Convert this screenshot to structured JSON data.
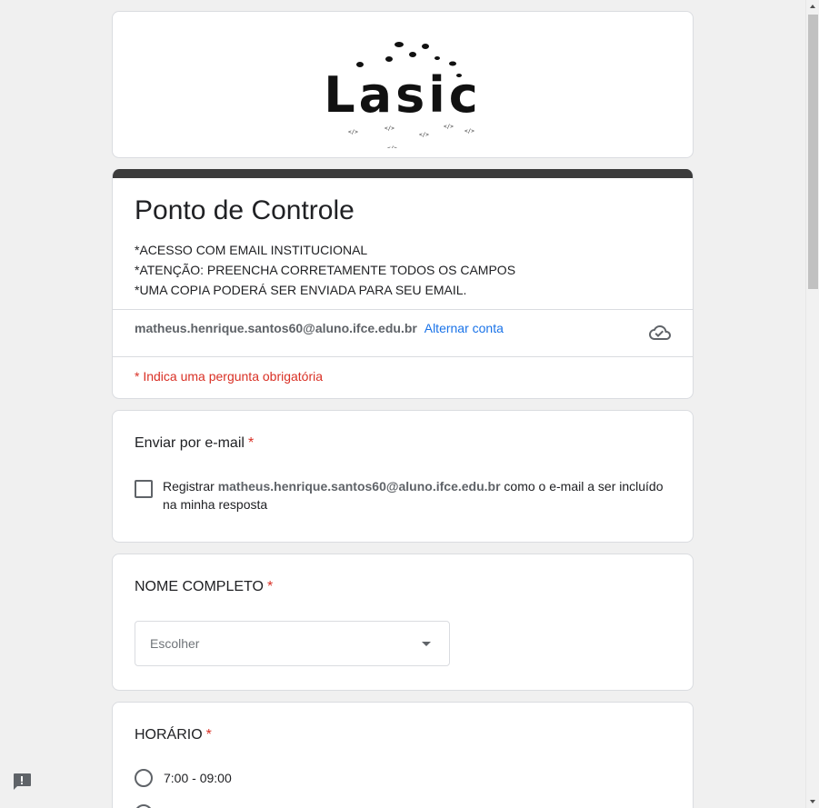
{
  "banner": {
    "logo_text": "Lasic"
  },
  "form": {
    "title": "Ponto de Controle",
    "description": [
      "*ACESSO COM EMAIL INSTITUCIONAL",
      "*ATENÇÃO: PREENCHA CORRETAMENTE TODOS OS CAMPOS",
      "*UMA COPIA PODERÁ SER ENVIADA PARA SEU EMAIL."
    ],
    "account_email": "matheus.henrique.santos60@aluno.ifce.edu.br",
    "switch_account": "Alternar conta",
    "required_note": "* Indica uma pergunta obrigatória"
  },
  "q_email": {
    "title": "Enviar por e-mail",
    "required_mark": "*",
    "checkbox_prefix": "Registrar ",
    "checkbox_email": "matheus.henrique.santos60@aluno.ifce.edu.br",
    "checkbox_suffix": " como o e-mail a ser incluído na minha resposta"
  },
  "q_name": {
    "title": "NOME COMPLETO",
    "required_mark": "*",
    "select_placeholder": "Escolher"
  },
  "q_time": {
    "title": "HORÁRIO",
    "required_mark": "*",
    "options": [
      "7:00 - 09:00"
    ]
  },
  "icons": {
    "cloud": "cloud-saved-icon",
    "feedback": "feedback-icon"
  }
}
